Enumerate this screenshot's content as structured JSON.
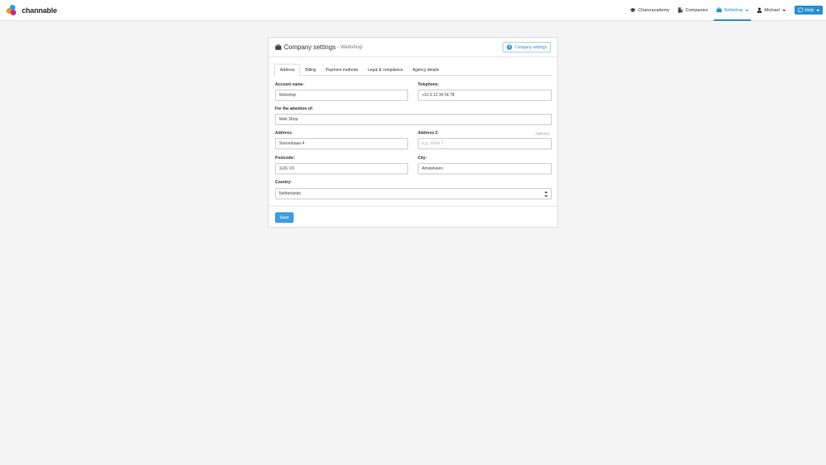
{
  "app": {
    "logo_text": "channable"
  },
  "nav": {
    "channacademy": "Channacademy",
    "companies": "Companies",
    "webshop": "Webshop",
    "user": "Michael",
    "help": "Help"
  },
  "panel": {
    "title": "Company settings",
    "subtitle": "- Webshop",
    "company_settings_button": "Company settings"
  },
  "tabs": [
    {
      "label": "Address"
    },
    {
      "label": "Billing"
    },
    {
      "label": "Payment methods"
    },
    {
      "label": "Legal & compliance"
    },
    {
      "label": "Agency details"
    }
  ],
  "form": {
    "account_name": {
      "label": "Account name:",
      "value": "Webshop"
    },
    "telephone": {
      "label": "Telephone:",
      "value": "+31 6 12 34 56 78"
    },
    "attention": {
      "label": "For the attention of:",
      "value": "Web Shop"
    },
    "address": {
      "label": "Address:",
      "value": "Stroombaan 4"
    },
    "address2": {
      "label": "Address 2:",
      "optional": "Optional",
      "placeholder": "e.g., Floor 1"
    },
    "postcode": {
      "label": "Postcode:",
      "value": "1181 VX"
    },
    "city": {
      "label": "City:",
      "value": "Amstelveen"
    },
    "country": {
      "label": "Country:",
      "value": "Netherlands"
    },
    "save_label": "Save"
  },
  "colors": {
    "accent": "#2a8fcf",
    "save": "#3d9de0"
  }
}
